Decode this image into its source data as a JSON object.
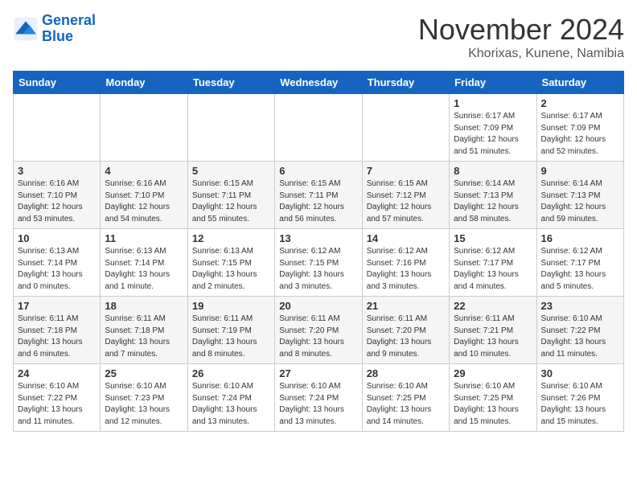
{
  "header": {
    "logo_line1": "General",
    "logo_line2": "Blue",
    "month": "November 2024",
    "location": "Khorixas, Kunene, Namibia"
  },
  "days_of_week": [
    "Sunday",
    "Monday",
    "Tuesday",
    "Wednesday",
    "Thursday",
    "Friday",
    "Saturday"
  ],
  "weeks": [
    [
      {
        "day": "",
        "info": ""
      },
      {
        "day": "",
        "info": ""
      },
      {
        "day": "",
        "info": ""
      },
      {
        "day": "",
        "info": ""
      },
      {
        "day": "",
        "info": ""
      },
      {
        "day": "1",
        "info": "Sunrise: 6:17 AM\nSunset: 7:09 PM\nDaylight: 12 hours\nand 51 minutes."
      },
      {
        "day": "2",
        "info": "Sunrise: 6:17 AM\nSunset: 7:09 PM\nDaylight: 12 hours\nand 52 minutes."
      }
    ],
    [
      {
        "day": "3",
        "info": "Sunrise: 6:16 AM\nSunset: 7:10 PM\nDaylight: 12 hours\nand 53 minutes."
      },
      {
        "day": "4",
        "info": "Sunrise: 6:16 AM\nSunset: 7:10 PM\nDaylight: 12 hours\nand 54 minutes."
      },
      {
        "day": "5",
        "info": "Sunrise: 6:15 AM\nSunset: 7:11 PM\nDaylight: 12 hours\nand 55 minutes."
      },
      {
        "day": "6",
        "info": "Sunrise: 6:15 AM\nSunset: 7:11 PM\nDaylight: 12 hours\nand 56 minutes."
      },
      {
        "day": "7",
        "info": "Sunrise: 6:15 AM\nSunset: 7:12 PM\nDaylight: 12 hours\nand 57 minutes."
      },
      {
        "day": "8",
        "info": "Sunrise: 6:14 AM\nSunset: 7:13 PM\nDaylight: 12 hours\nand 58 minutes."
      },
      {
        "day": "9",
        "info": "Sunrise: 6:14 AM\nSunset: 7:13 PM\nDaylight: 12 hours\nand 59 minutes."
      }
    ],
    [
      {
        "day": "10",
        "info": "Sunrise: 6:13 AM\nSunset: 7:14 PM\nDaylight: 13 hours\nand 0 minutes."
      },
      {
        "day": "11",
        "info": "Sunrise: 6:13 AM\nSunset: 7:14 PM\nDaylight: 13 hours\nand 1 minute."
      },
      {
        "day": "12",
        "info": "Sunrise: 6:13 AM\nSunset: 7:15 PM\nDaylight: 13 hours\nand 2 minutes."
      },
      {
        "day": "13",
        "info": "Sunrise: 6:12 AM\nSunset: 7:15 PM\nDaylight: 13 hours\nand 3 minutes."
      },
      {
        "day": "14",
        "info": "Sunrise: 6:12 AM\nSunset: 7:16 PM\nDaylight: 13 hours\nand 3 minutes."
      },
      {
        "day": "15",
        "info": "Sunrise: 6:12 AM\nSunset: 7:17 PM\nDaylight: 13 hours\nand 4 minutes."
      },
      {
        "day": "16",
        "info": "Sunrise: 6:12 AM\nSunset: 7:17 PM\nDaylight: 13 hours\nand 5 minutes."
      }
    ],
    [
      {
        "day": "17",
        "info": "Sunrise: 6:11 AM\nSunset: 7:18 PM\nDaylight: 13 hours\nand 6 minutes."
      },
      {
        "day": "18",
        "info": "Sunrise: 6:11 AM\nSunset: 7:18 PM\nDaylight: 13 hours\nand 7 minutes."
      },
      {
        "day": "19",
        "info": "Sunrise: 6:11 AM\nSunset: 7:19 PM\nDaylight: 13 hours\nand 8 minutes."
      },
      {
        "day": "20",
        "info": "Sunrise: 6:11 AM\nSunset: 7:20 PM\nDaylight: 13 hours\nand 8 minutes."
      },
      {
        "day": "21",
        "info": "Sunrise: 6:11 AM\nSunset: 7:20 PM\nDaylight: 13 hours\nand 9 minutes."
      },
      {
        "day": "22",
        "info": "Sunrise: 6:11 AM\nSunset: 7:21 PM\nDaylight: 13 hours\nand 10 minutes."
      },
      {
        "day": "23",
        "info": "Sunrise: 6:10 AM\nSunset: 7:22 PM\nDaylight: 13 hours\nand 11 minutes."
      }
    ],
    [
      {
        "day": "24",
        "info": "Sunrise: 6:10 AM\nSunset: 7:22 PM\nDaylight: 13 hours\nand 11 minutes."
      },
      {
        "day": "25",
        "info": "Sunrise: 6:10 AM\nSunset: 7:23 PM\nDaylight: 13 hours\nand 12 minutes."
      },
      {
        "day": "26",
        "info": "Sunrise: 6:10 AM\nSunset: 7:24 PM\nDaylight: 13 hours\nand 13 minutes."
      },
      {
        "day": "27",
        "info": "Sunrise: 6:10 AM\nSunset: 7:24 PM\nDaylight: 13 hours\nand 13 minutes."
      },
      {
        "day": "28",
        "info": "Sunrise: 6:10 AM\nSunset: 7:25 PM\nDaylight: 13 hours\nand 14 minutes."
      },
      {
        "day": "29",
        "info": "Sunrise: 6:10 AM\nSunset: 7:25 PM\nDaylight: 13 hours\nand 15 minutes."
      },
      {
        "day": "30",
        "info": "Sunrise: 6:10 AM\nSunset: 7:26 PM\nDaylight: 13 hours\nand 15 minutes."
      }
    ]
  ]
}
